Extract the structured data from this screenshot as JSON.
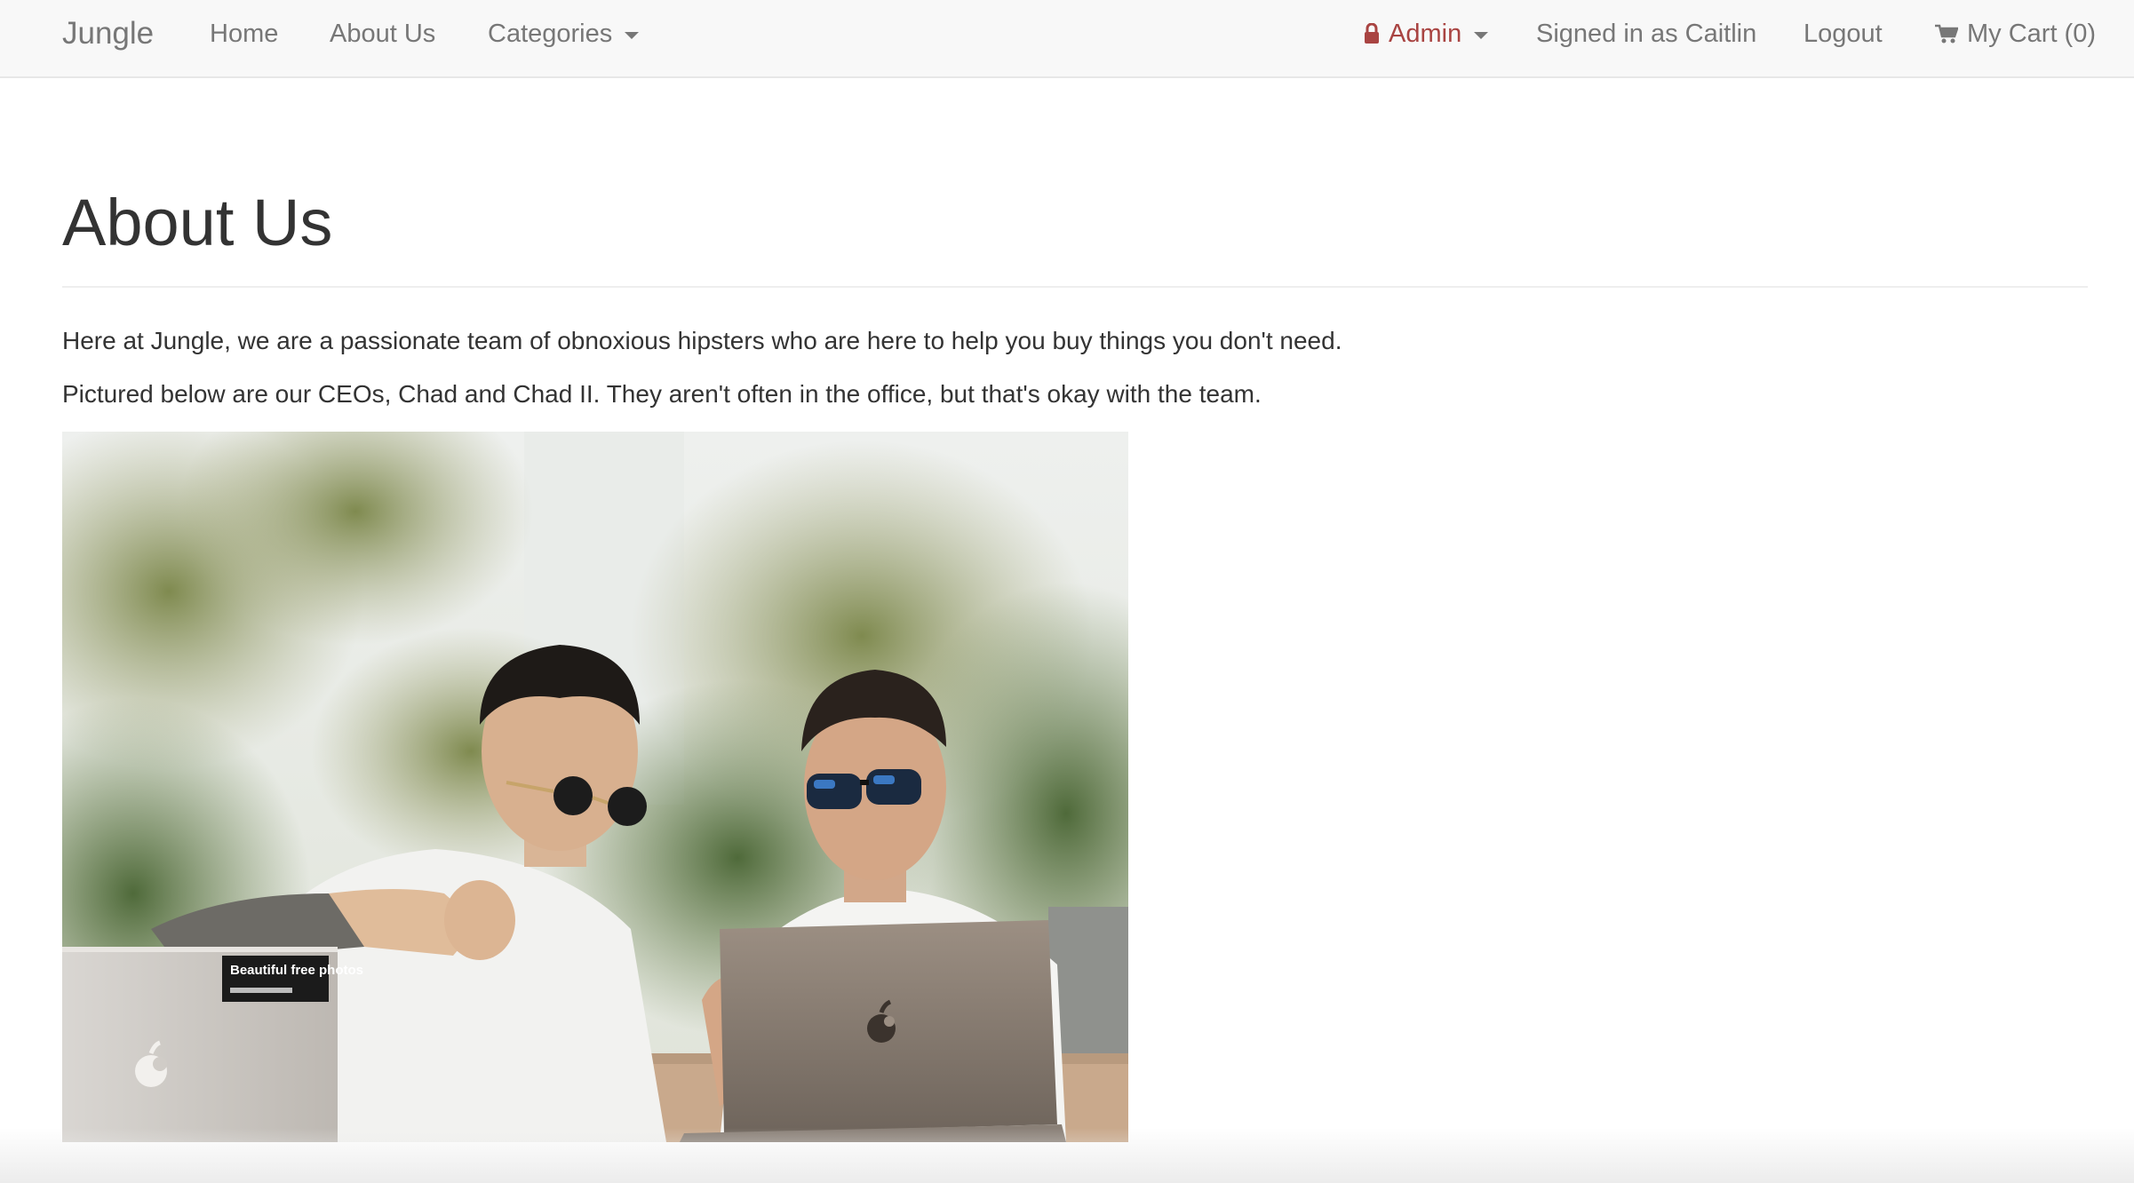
{
  "navbar": {
    "brand": "Jungle",
    "links": {
      "home": "Home",
      "about": "About Us",
      "categories": "Categories"
    },
    "admin_label": "Admin",
    "signed_in": "Signed in as Caitlin",
    "logout": "Logout",
    "cart": "My Cart (0)"
  },
  "page": {
    "title": "About Us",
    "paragraphs": [
      "Here at Jungle, we are a passionate team of obnoxious hipsters who are here to help you buy things you don't need.",
      "Pictured below are our CEOs, Chad and Chad II. They aren't often in the office, but that's okay with the team."
    ],
    "laptop_sticker": "Beautiful free photos"
  },
  "colors": {
    "admin_accent": "#a94442",
    "nav_text": "#777777",
    "navbar_bg": "#f8f8f8"
  },
  "icons": [
    "lock-icon",
    "caret-down-icon",
    "shopping-cart-icon",
    "apple-logo-icon"
  ]
}
